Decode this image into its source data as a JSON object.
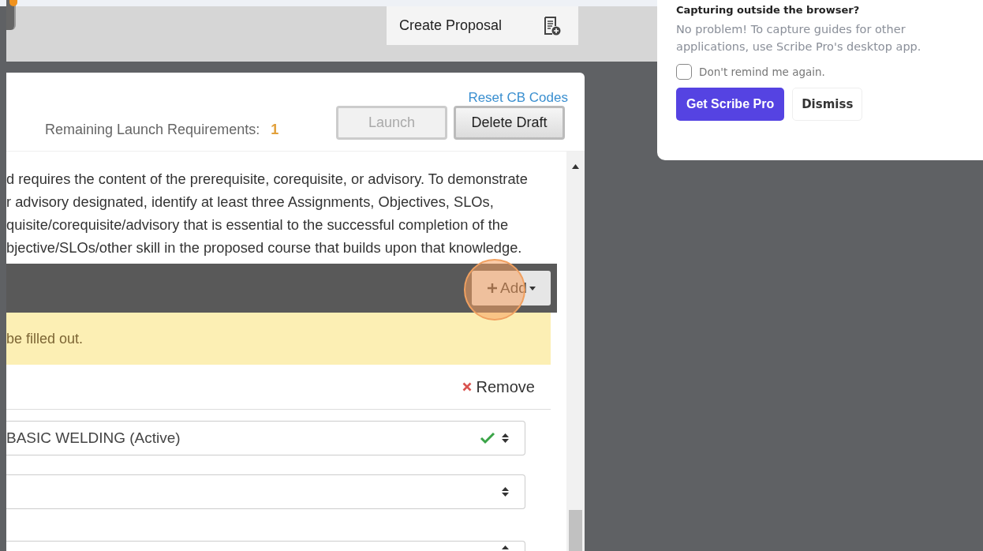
{
  "toolbar": {
    "create_button": "Create Proposal"
  },
  "header": {
    "reset_link": "Reset CB Codes",
    "requirements_label": "Remaining Launch Requirements:",
    "requirements_count": "1",
    "buttons": [
      {
        "label": "Launch",
        "disabled": true
      },
      {
        "label": "Delete Draft",
        "disabled": false
      }
    ]
  },
  "instructions": [
    "d requires the content of the prerequisite, corequisite, or advisory. To demonstrate",
    "r advisory designated, identify at least three Assignments, Objectives, SLOs,",
    "quisite/corequisite/advisory that is essential to the successful completion of the",
    "bjective/SLOs/other skill in the proposed course that builds upon that knowledge."
  ],
  "section_bar": {
    "add_button": "Add"
  },
  "alert": "be filled out.",
  "entry": {
    "remove_button": "Remove",
    "fields": [
      {
        "value": "BASIC WELDING (Active)",
        "valid": true
      },
      {
        "valid": false
      },
      {
        "valid": false
      }
    ]
  },
  "popup": {
    "title": "Capturing outside the browser?",
    "body": "No problem! To capture guides for other applications, use Scribe Pro's desktop app.",
    "checkbox": {
      "label": "Don't remind me again.",
      "checked": false
    },
    "primary_button": "Get Scribe Pro",
    "secondary_button": "Dismiss"
  }
}
